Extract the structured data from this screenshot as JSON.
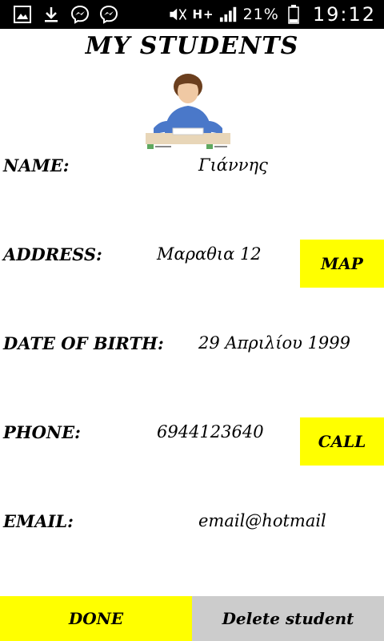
{
  "status_bar": {
    "icons_left": [
      "gallery-icon",
      "download-icon",
      "messenger-icon",
      "messenger-icon"
    ],
    "network": "H+",
    "battery": "21%",
    "time": "19:12"
  },
  "header": {
    "title": "MY STUDENTS"
  },
  "student": {
    "name_label": "NAME:",
    "name": "Γιάννης",
    "address_label": "ADDRESS:",
    "address": "Μαραθια 12",
    "map_button": "MAP",
    "dob_label": "DATE OF BIRTH:",
    "dob": "29 Απριλίου 1999",
    "phone_label": "PHONE:",
    "phone": "6944123640",
    "call_button": "CALL",
    "email_label": "EMAIL:",
    "email": "email@hotmail"
  },
  "footer": {
    "done_label": "DONE",
    "delete_label": "Delete student"
  },
  "colors": {
    "accent": "#ffff00",
    "secondary_button": "#cccccc",
    "status_bar": "#000000"
  }
}
